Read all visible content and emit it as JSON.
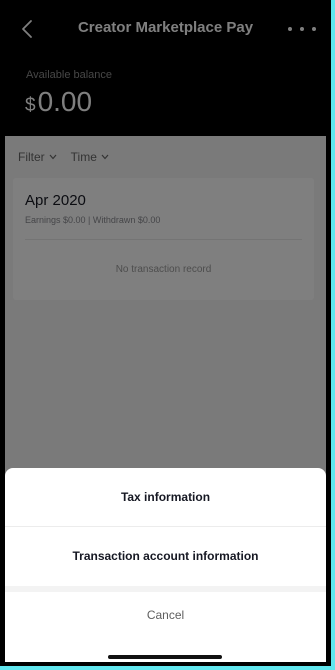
{
  "header": {
    "title": "Creator Marketplace Pay",
    "back_icon": "chevron-left-icon",
    "more_icon": "more-horizontal-icon",
    "balance_label": "Available balance",
    "currency": "$",
    "amount": "0.00"
  },
  "filters": [
    {
      "label": "Filter",
      "icon": "chevron-down-icon"
    },
    {
      "label": "Time",
      "icon": "chevron-down-icon"
    }
  ],
  "card": {
    "month": "Apr 2020",
    "summary": "Earnings $0.00 | Withdrawn $0.00",
    "empty": "No transaction record"
  },
  "sheet": {
    "tax": "Tax information",
    "account": "Transaction account information",
    "cancel": "Cancel"
  },
  "colors": {
    "frame_border": "#5fe6ee",
    "header_bg": "#000000",
    "overlay": "rgba(0,0,0,0.5)"
  }
}
